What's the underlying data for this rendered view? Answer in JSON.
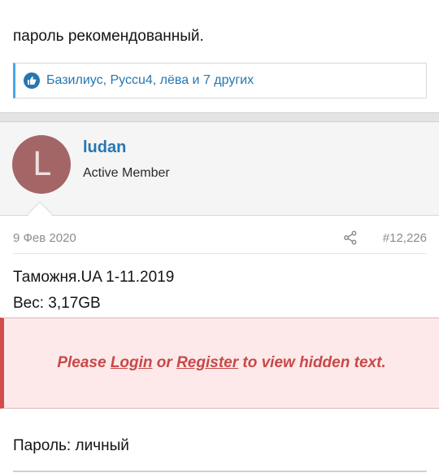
{
  "top": {
    "text": "пароль рекомендованный."
  },
  "reactions": {
    "text": "Базилиус, Руссu4, лёва и 7 других"
  },
  "user": {
    "avatar_letter": "L",
    "name": "ludan",
    "title": "Active Member"
  },
  "post": {
    "date": "9 Фев 2020",
    "number": "#12,226",
    "line1": "Таможня.UA 1-11.2019",
    "line2": "Вес: 3,17GB",
    "password": "Пароль: личный"
  },
  "hidden": {
    "prefix": "Please ",
    "login": "Login",
    "middle": " or ",
    "register": "Register",
    "suffix": " to view hidden text."
  },
  "colors": {
    "link": "#2577b1",
    "avatar": "#a36565",
    "warning": "#c84848"
  },
  "icons": {
    "reaction": "like-icon",
    "share": "share-icon"
  }
}
